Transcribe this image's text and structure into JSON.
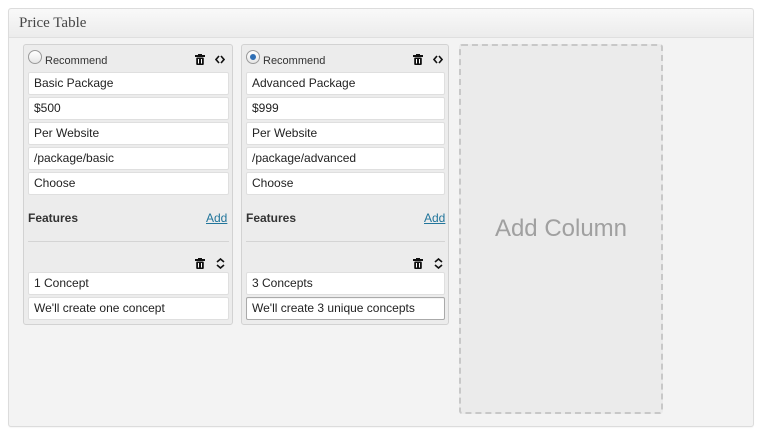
{
  "panel": {
    "title": "Price Table"
  },
  "columns": [
    {
      "recommended": false,
      "recommend_label": "Recommend",
      "name": "Basic Package",
      "price": "$500",
      "period": "Per Website",
      "url": "/package/basic",
      "button_text": "Choose",
      "features_label": "Features",
      "add_label": "Add",
      "features": [
        {
          "title": "1 Concept",
          "description": "We'll create one concept"
        }
      ]
    },
    {
      "recommended": true,
      "recommend_label": "Recommend",
      "name": "Advanced Package",
      "price": "$999",
      "period": "Per Website",
      "url": "/package/advanced",
      "button_text": "Choose",
      "features_label": "Features",
      "add_label": "Add",
      "features": [
        {
          "title": "3 Concepts",
          "description": "We'll create 3 unique concepts"
        }
      ]
    }
  ],
  "add_column_label": "Add Column",
  "icons": [
    "trash-icon",
    "code-arrows-icon",
    "sort-arrows-icon"
  ],
  "colors": {
    "link": "#21759b",
    "radio_checked": "#2f6fb5",
    "placeholder_text": "#a0a0a0"
  }
}
